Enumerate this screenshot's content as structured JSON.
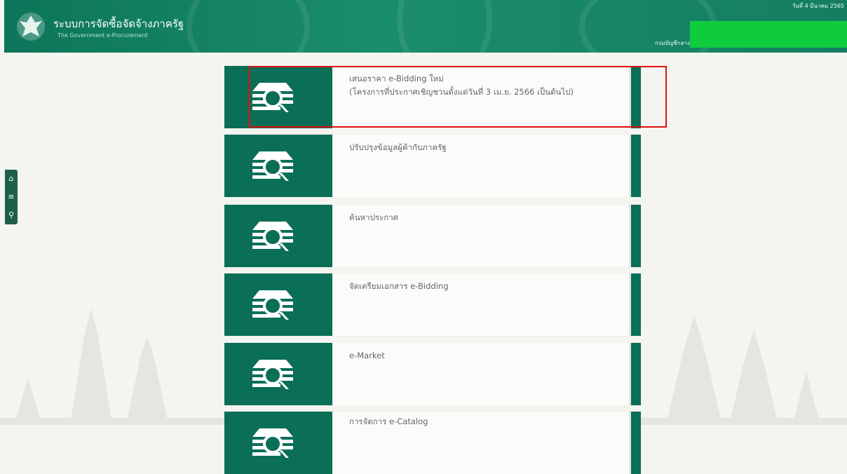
{
  "header": {
    "title": "ระบบการจัดซื้อจัดจ้างภาครัฐ",
    "subtitle": "The Government e-Procurement",
    "date": "วันที่ 4 มีนาคม 2565",
    "department": "กรมบัญชีกลาง",
    "colors": {
      "primary": "#0d7559",
      "redacted_block": "#0fcc3d"
    }
  },
  "toolbar": {
    "items": [
      {
        "icon": "home-icon",
        "glyph": "⌂"
      },
      {
        "icon": "menu-icon",
        "glyph": "≡"
      },
      {
        "icon": "search-icon",
        "glyph": "⚲"
      }
    ]
  },
  "menu": {
    "items": [
      {
        "line1": "เสนอราคา e-Bidding ใหม่",
        "line2": "(โครงการที่ประกาศเชิญชวนตั้งแต่วันที่ 3 เม.ย. 2566 เป็นต้นไป)",
        "highlighted": true
      },
      {
        "line1": "ปรับปรุงข้อมูลผู้ค้ากับภาครัฐ",
        "line2": ""
      },
      {
        "line1": "ค้นหาประกาศ",
        "line2": ""
      },
      {
        "line1": "จัดเตรียมเอกสาร e-Bidding",
        "line2": ""
      },
      {
        "line1": "e-Market",
        "line2": ""
      },
      {
        "line1": "การจัดการ e-Catalog",
        "line2": ""
      }
    ],
    "colors": {
      "accent": "#0b6e57",
      "highlight": "#e01010"
    }
  }
}
